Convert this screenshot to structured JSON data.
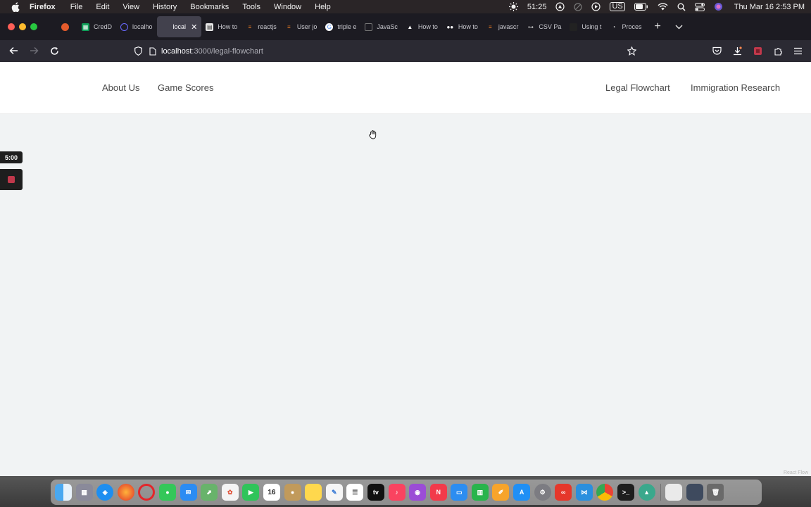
{
  "menubar": {
    "app_name": "Firefox",
    "items": [
      "File",
      "Edit",
      "View",
      "History",
      "Bookmarks",
      "Tools",
      "Window",
      "Help"
    ],
    "recording_time": "51:25",
    "input_source": "US",
    "datetime": "Thu Mar 16  2:53 PM"
  },
  "tabs": [
    {
      "label": "CredD",
      "color": "#0f9d58"
    },
    {
      "label": "localho",
      "color": "#3b3a45"
    },
    {
      "label": "local",
      "color": "#3b3a45",
      "active": true
    },
    {
      "label": "How to",
      "color": "#555555"
    },
    {
      "label": "reactjs",
      "color": "#f48024"
    },
    {
      "label": "User jo",
      "color": "#f48024"
    },
    {
      "label": "triple e",
      "color": "#4285f4"
    },
    {
      "label": "JavaSc",
      "color": "#3b3a45"
    },
    {
      "label": "How to",
      "color": "#222222"
    },
    {
      "label": "How to",
      "color": "#111111"
    },
    {
      "label": "javascr",
      "color": "#f48024"
    },
    {
      "label": "CSV Pa",
      "color": "#333333"
    },
    {
      "label": "Using t",
      "color": "#222222"
    },
    {
      "label": "Proces",
      "color": "#888888"
    }
  ],
  "address": {
    "host": "localhost",
    "path": ":3000/legal-flowchart"
  },
  "site_nav": {
    "about": "About Us",
    "scores": "Game Scores",
    "flowchart": "Legal Flowchart",
    "research": "Immigration Research"
  },
  "recorder": {
    "timer": "5:00"
  },
  "attribution": "React Flow",
  "dock": {
    "calendar_day": "16",
    "apps": [
      "finder",
      "launchpad",
      "safari",
      "firefox",
      "opera",
      "messages",
      "mail",
      "maps",
      "photos",
      "facetime",
      "calendar",
      "contacts",
      "notes",
      "freeform",
      "reminders",
      "tv",
      "music",
      "podcasts",
      "news",
      "keynote",
      "numbers",
      "pages",
      "app-store",
      "system-settings",
      "creative-cloud",
      "vscode",
      "chrome",
      "terminal",
      "monitor",
      "downloads-stack",
      "screenshot",
      "trash"
    ]
  }
}
